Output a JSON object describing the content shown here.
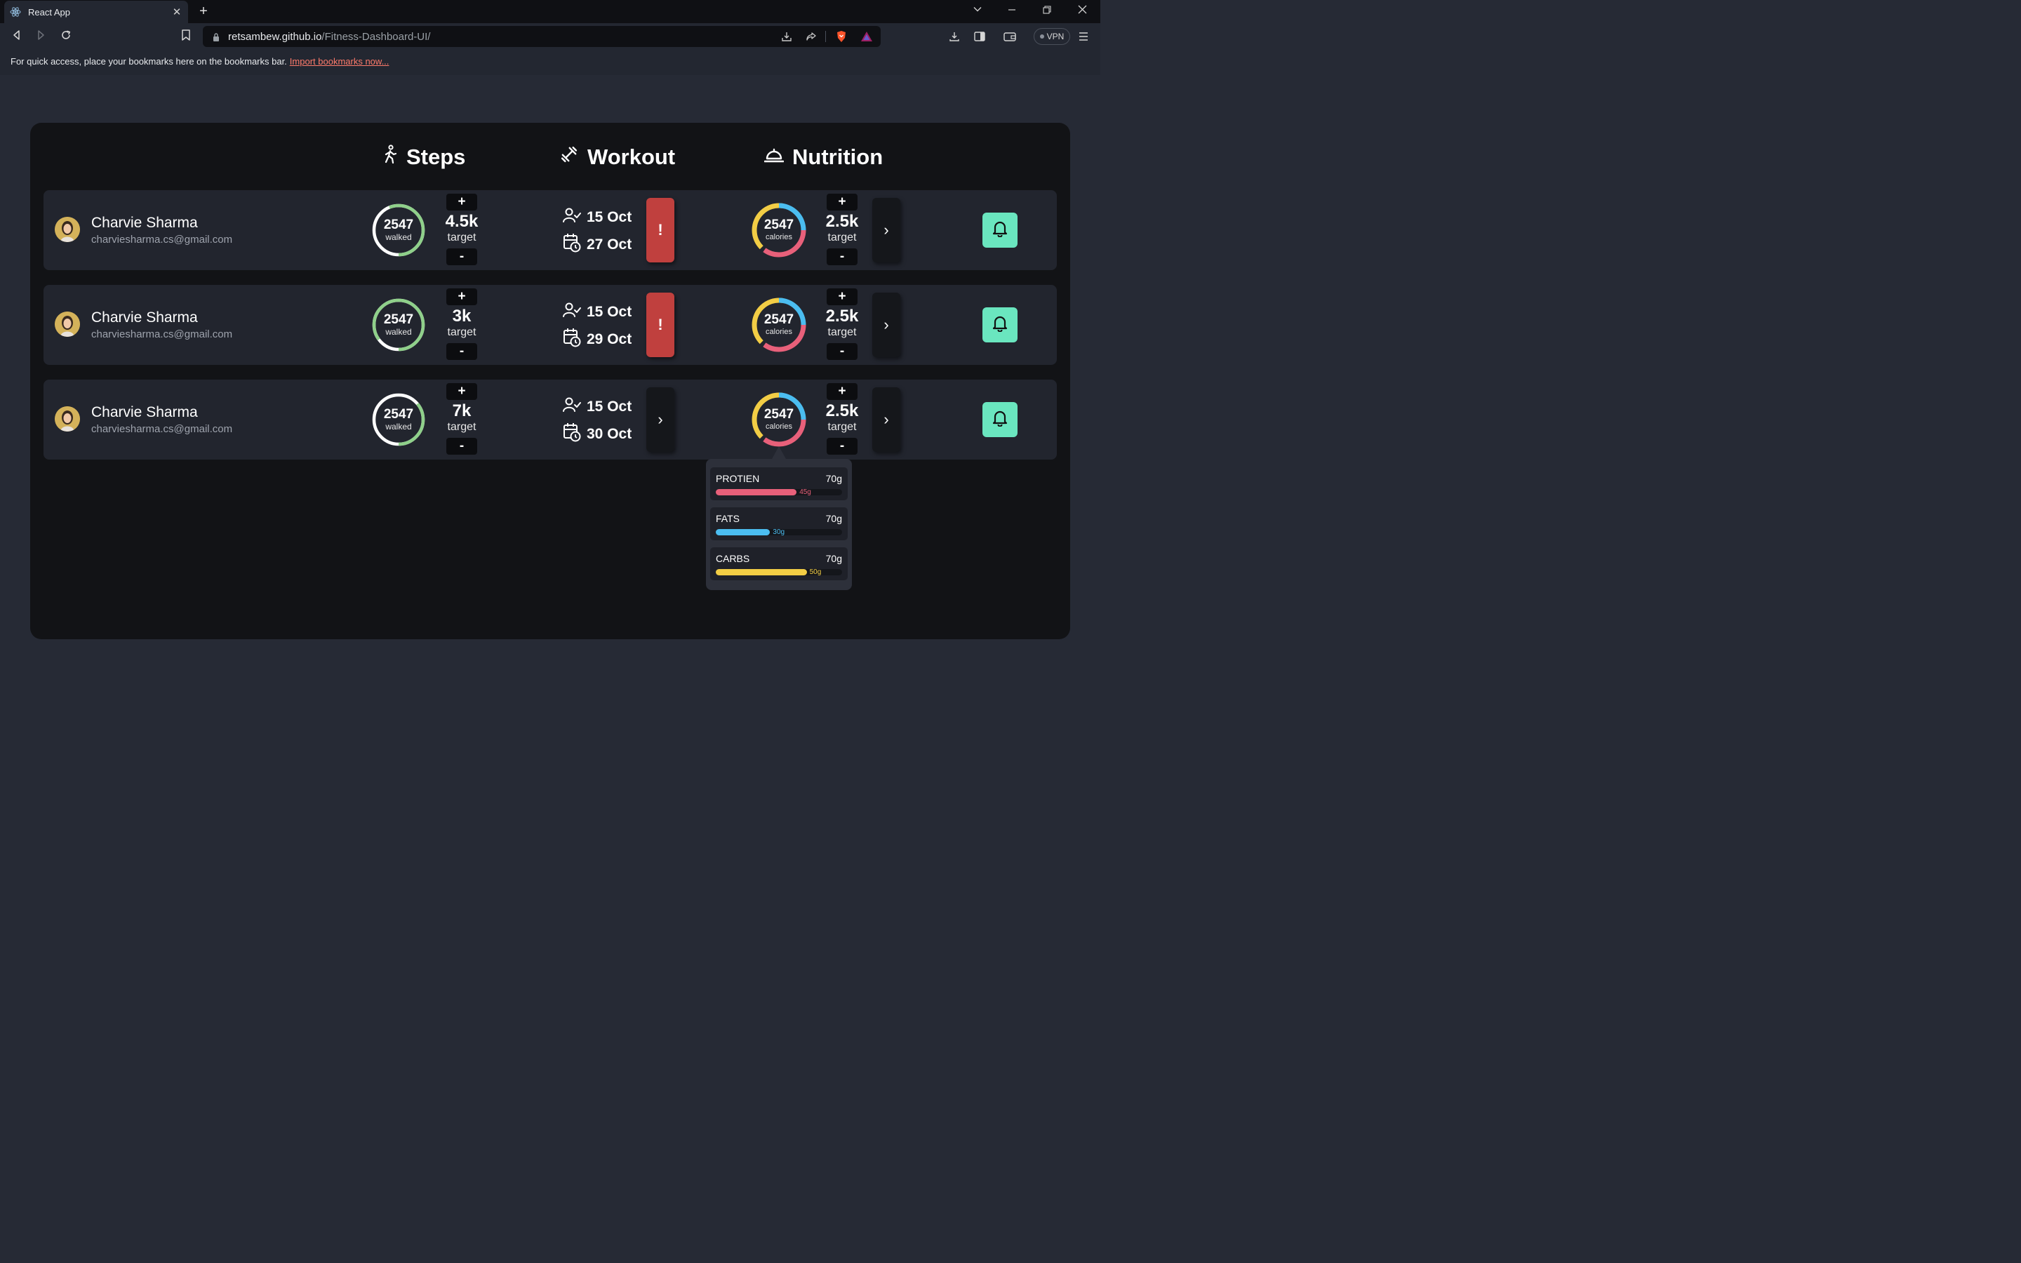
{
  "browser": {
    "tab_title": "React App",
    "tab_close": "✕",
    "new_tab": "+",
    "url_domain": "retsambew.github.io",
    "url_path": "/Fitness-Dashboard-UI/",
    "vpn_label": "VPN",
    "bookmarks_message": "For quick access, place your bookmarks here on the bookmarks bar.",
    "bookmarks_import": "Import bookmarks now..."
  },
  "headers": {
    "steps": "Steps",
    "workout": "Workout",
    "nutrition": "Nutrition"
  },
  "rows": [
    {
      "name": "Charvie Sharma",
      "email": "charviesharma.cs@gmail.com",
      "steps_walked": "2547",
      "steps_walked_label": "walked",
      "steps_target": "4.5k",
      "target_label": "target",
      "plus": "+",
      "minus": "-",
      "workout_start": "15 Oct",
      "workout_due": "27 Oct",
      "workout_action": "!",
      "calories": "2547",
      "calories_label": "calories",
      "calorie_target": "2.5k",
      "nutrition_action": "›",
      "steps_progress": 0.56
    },
    {
      "name": "Charvie Sharma",
      "email": "charviesharma.cs@gmail.com",
      "steps_walked": "2547",
      "steps_walked_label": "walked",
      "steps_target": "3k",
      "target_label": "target",
      "plus": "+",
      "minus": "-",
      "workout_start": "15 Oct",
      "workout_due": "29 Oct",
      "workout_action": "!",
      "calories": "2547",
      "calories_label": "calories",
      "calorie_target": "2.5k",
      "nutrition_action": "›",
      "steps_progress": 0.85
    },
    {
      "name": "Charvie Sharma",
      "email": "charviesharma.cs@gmail.com",
      "steps_walked": "2547",
      "steps_walked_label": "walked",
      "steps_target": "7k",
      "target_label": "target",
      "plus": "+",
      "minus": "-",
      "workout_start": "15 Oct",
      "workout_due": "30 Oct",
      "workout_action": "›",
      "calories": "2547",
      "calories_label": "calories",
      "calorie_target": "2.5k",
      "nutrition_action": "›",
      "steps_progress": 0.36
    }
  ],
  "nutrition_popup": {
    "macros": [
      {
        "name": "PROTIEN",
        "total": "70g",
        "amount": "45g",
        "fraction": 0.64,
        "color": "#e8607a"
      },
      {
        "name": "FATS",
        "total": "70g",
        "amount": "30g",
        "fraction": 0.43,
        "color": "#4bbdf0"
      },
      {
        "name": "CARBS",
        "total": "70g",
        "amount": "50g",
        "fraction": 0.72,
        "color": "#f2cd45"
      }
    ]
  },
  "colors": {
    "steps_ring": "#8fd08a",
    "alert": "#c0403e",
    "bell": "#6ae6bf",
    "protein": "#e8607a",
    "fats": "#4bbdf0",
    "carbs": "#f2cd45"
  }
}
